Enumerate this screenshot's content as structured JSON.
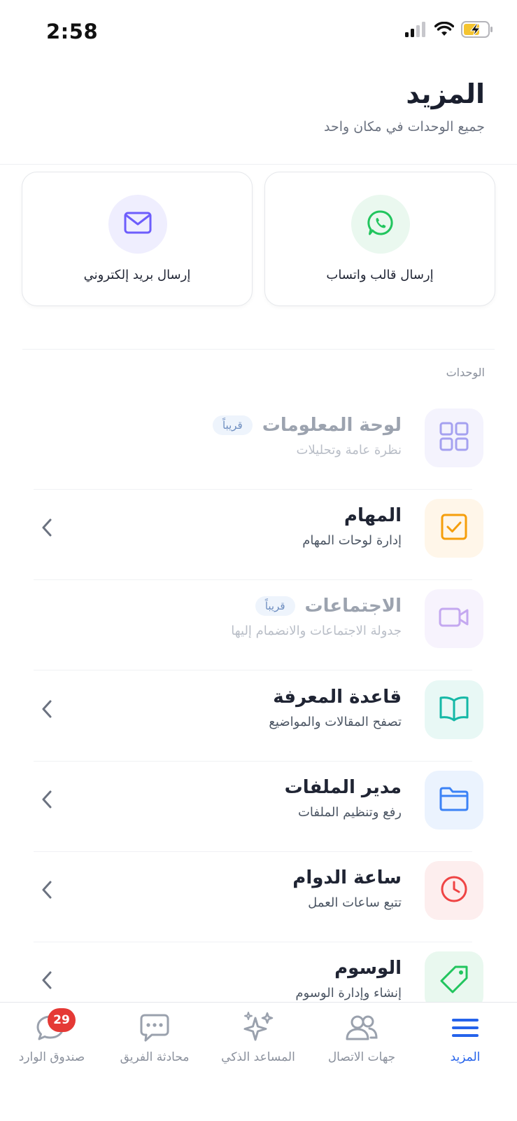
{
  "status_bar": {
    "time": "2:58"
  },
  "header": {
    "title": "المزيد",
    "subtitle": "جميع الوحدات في مكان واحد"
  },
  "quick_actions": [
    {
      "label": "إرسال قالب واتساب",
      "icon": "whatsapp-icon",
      "color": "#22c55e",
      "bg": "#eaf8ef"
    },
    {
      "label": "إرسال بريد إلكتروني",
      "icon": "mail-icon",
      "color": "#6d5dfc",
      "bg": "#efeefe"
    }
  ],
  "section_label": "الوحدات",
  "modules": [
    {
      "title": "لوحة المعلومات",
      "subtitle": "نظرة عامة وتحليلات",
      "badge": "قريباً",
      "icon": "grid-icon",
      "color": "#a5a1f0",
      "bg": "#f4f3fd",
      "disabled": true
    },
    {
      "title": "المهام",
      "subtitle": "إدارة لوحات المهام",
      "icon": "checkbox-icon",
      "color": "#f59e0b",
      "bg": "#fff6e9",
      "disabled": false
    },
    {
      "title": "الاجتماعات",
      "subtitle": "جدولة الاجتماعات والانضمام إليها",
      "badge": "قريباً",
      "icon": "video-icon",
      "color": "#c4a8f0",
      "bg": "#f7f3fd",
      "disabled": true
    },
    {
      "title": "قاعدة المعرفة",
      "subtitle": "تصفح المقالات والمواضيع",
      "icon": "book-icon",
      "color": "#14b8a6",
      "bg": "#e8f8f5",
      "disabled": false
    },
    {
      "title": "مدير الملفات",
      "subtitle": "رفع وتنظيم الملفات",
      "icon": "folder-icon",
      "color": "#3b82f6",
      "bg": "#ebf3fe",
      "disabled": false
    },
    {
      "title": "ساعة الدوام",
      "subtitle": "تتبع ساعات العمل",
      "icon": "clock-icon",
      "color": "#ef4444",
      "bg": "#fdeeee",
      "disabled": false
    },
    {
      "title": "الوسوم",
      "subtitle": "إنشاء وإدارة الوسوم",
      "icon": "tag-icon",
      "color": "#22c55e",
      "bg": "#e9f8ef",
      "disabled": false
    }
  ],
  "tab_bar": {
    "items": [
      {
        "label": "المزيد",
        "icon": "menu-icon",
        "active": true
      },
      {
        "label": "جهات الاتصال",
        "icon": "contacts-icon",
        "active": false
      },
      {
        "label": "المساعد الذكي",
        "icon": "sparkles-icon",
        "active": false
      },
      {
        "label": "محادثة الفريق",
        "icon": "team-chat-icon",
        "active": false
      },
      {
        "label": "صندوق الوارد",
        "icon": "inbox-chat-icon",
        "active": false,
        "badge": "29"
      }
    ],
    "active_color": "#2563eb",
    "inactive_color": "#9aa1ad"
  }
}
